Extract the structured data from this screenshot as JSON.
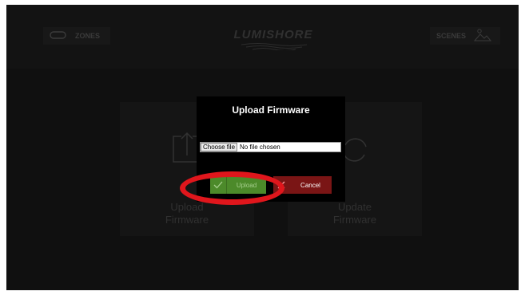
{
  "header": {
    "zones_label": "ZONES",
    "brand": "LUMISHORE",
    "scenes_label": "SCENES"
  },
  "tiles": {
    "upload_line1": "Upload",
    "upload_line2": "Firmware",
    "update_line1": "Update",
    "update_line2": "Firmware"
  },
  "dialog": {
    "title": "Upload Firmware",
    "choose_file_label": "Choose file",
    "file_status": "No file chosen",
    "upload_label": "Upload",
    "cancel_label": "Cancel"
  },
  "colors": {
    "upload_button": "#4c8a2a",
    "cancel_button": "#7a1515",
    "highlight_annotation": "#e0161c"
  }
}
